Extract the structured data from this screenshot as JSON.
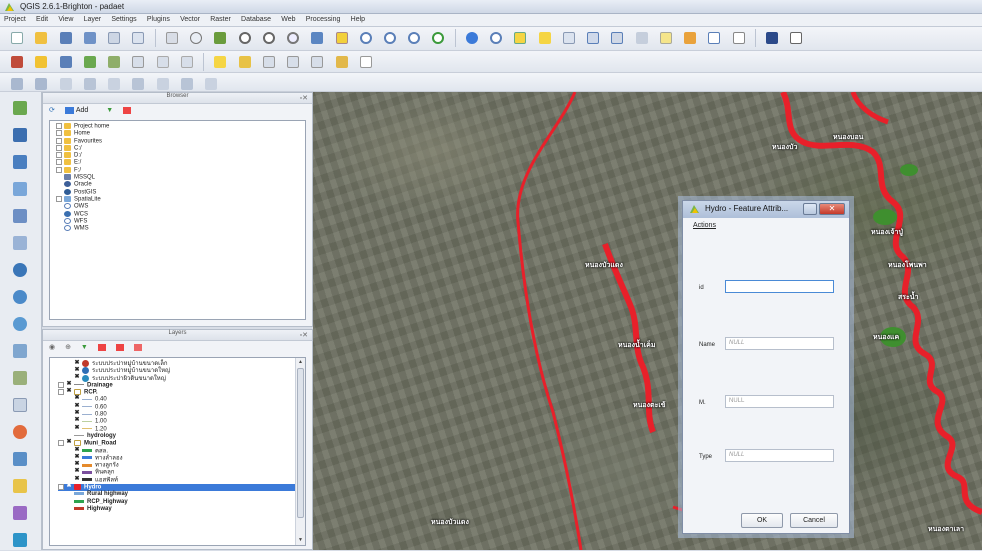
{
  "window": {
    "title": "QGIS 2.6.1-Brighton - padaet"
  },
  "menu": [
    "Project",
    "Edit",
    "View",
    "Layer",
    "Settings",
    "Plugins",
    "Vector",
    "Raster",
    "Database",
    "Web",
    "Processing",
    "Help"
  ],
  "browser": {
    "title": "Browser",
    "add_label": "Add",
    "items": [
      "Project home",
      "Home",
      "Favourites",
      "C:/",
      "D:/",
      "E:/",
      "F:/",
      "MSSQL",
      "Oracle",
      "PostGIS",
      "SpatiaLite",
      "OWS",
      "WCS",
      "WFS",
      "WMS"
    ]
  },
  "layers": {
    "title": "Layers",
    "items": [
      "ระบบประปาหมู่บ้านขนาดเล็ก",
      "ระบบประปาหมู่บ้านขนาดใหญ่",
      "ระบบประปาผิวดินขนาดใหญ่",
      "Drainage",
      "RCP.",
      "0.40",
      "0.60",
      "0.80",
      "1.00",
      "1.20",
      "hydrology",
      "Muni_Road",
      "คสล.",
      "ทางลำลอง",
      "ทางลูกรัง",
      "หินคลุก",
      "แอสฟัลท์",
      "Hydro",
      "Rural highway",
      "RCP_Highway",
      "Highway"
    ]
  },
  "map": {
    "labels": [
      "หนองบัวแดง",
      "หนองบัวแดง",
      "หนองบัว",
      "หนองบอน",
      "หนองเจ้าปู่",
      "หนองโพนพา",
      "สระน้ำ",
      "หนองน้ำเค็ม",
      "หนองแค",
      "หนองตะเข้",
      "หนองตาเลา"
    ]
  },
  "dialog": {
    "title": "Hydro - Feature Attrib...",
    "actions_label": "Actions",
    "fields": [
      {
        "label": "id",
        "value": ""
      },
      {
        "label": "Name",
        "value": "NULL"
      },
      {
        "label": "M.",
        "value": "NULL"
      },
      {
        "label": "Type",
        "value": "NULL"
      }
    ],
    "ok_label": "OK",
    "cancel_label": "Cancel"
  },
  "colors": {
    "river": "#e8202a",
    "selection": "#3b7ad9",
    "title_bar": "#cfd8e6"
  }
}
